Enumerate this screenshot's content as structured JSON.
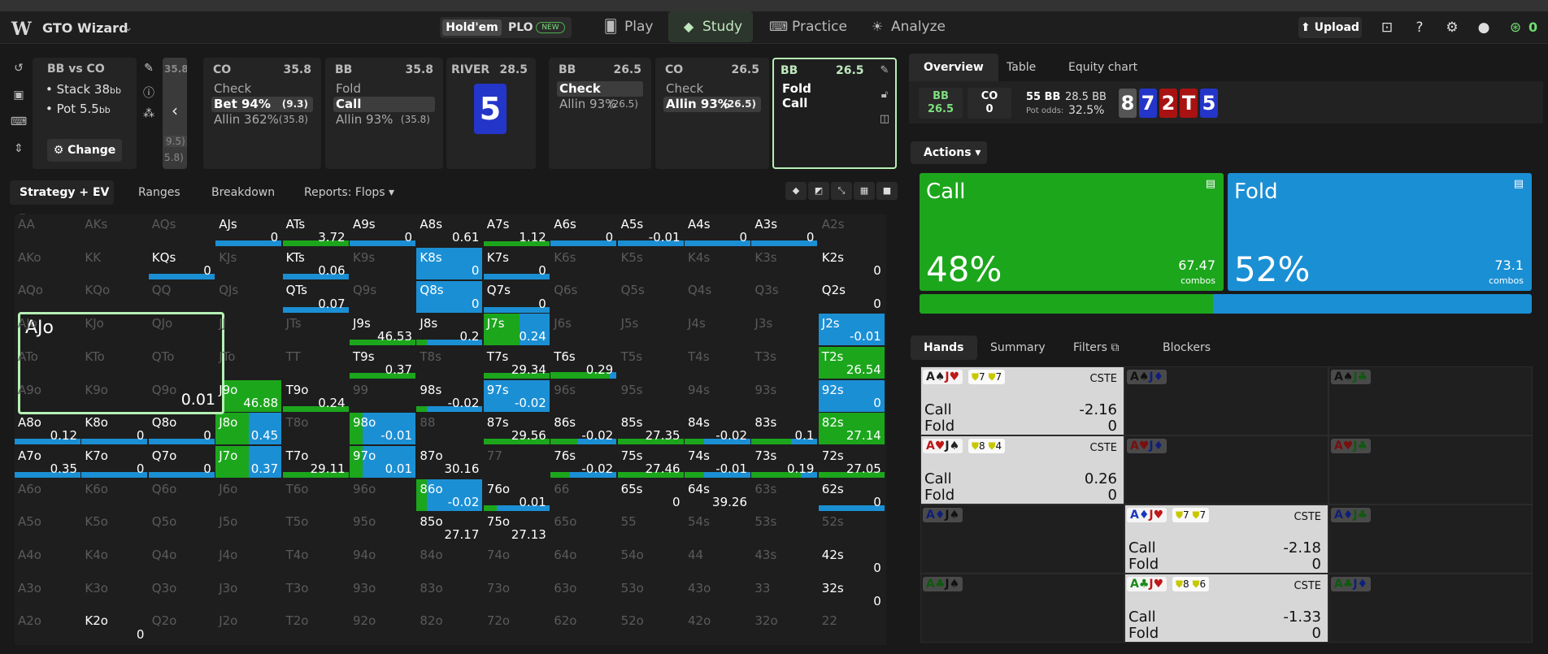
{
  "app": {
    "title": "GTO Wizard",
    "credit": "0"
  },
  "nav": {
    "holdem": "Hold'em",
    "plo": "PLO",
    "new_badge": "NEW",
    "tabs": [
      "Play",
      "Study",
      "Practice",
      "Analyze"
    ],
    "upload": "Upload"
  },
  "spot": {
    "title": "BB vs CO",
    "stack_label": "• Stack 38",
    "stack_unit": "bb",
    "pot_label": "• Pot 5.5",
    "pot_unit": "bb",
    "change": "Change"
  },
  "prev_card": {
    "amount": "35.8",
    "r1": "9.5)",
    "r2": "5.8)"
  },
  "cards": [
    {
      "pos": "CO",
      "amt": "35.8",
      "rows": [
        {
          "label": "Check",
          "sub": "",
          "sel": false
        },
        {
          "label": "Bet 94%",
          "sub": "(9.3)",
          "sel": true
        },
        {
          "label": "Allin 362%",
          "sub": "(35.8)",
          "sel": false
        }
      ]
    },
    {
      "pos": "BB",
      "amt": "35.8",
      "rows": [
        {
          "label": "Fold",
          "sub": "",
          "sel": false
        },
        {
          "label": "Call",
          "sub": "",
          "sel": true
        },
        {
          "label": "Allin 93%",
          "sub": "(35.8)",
          "sel": false
        }
      ]
    },
    {
      "pos": "BB",
      "amt": "26.5",
      "rows": [
        {
          "label": "Check",
          "sub": "",
          "sel": true
        },
        {
          "label": "Allin 93%",
          "sub": "(26.5)",
          "sel": false
        }
      ]
    },
    {
      "pos": "CO",
      "amt": "26.5",
      "rows": [
        {
          "label": "Check",
          "sub": "",
          "sel": false
        },
        {
          "label": "Allin 93%",
          "sub": "(26.5)",
          "sel": true
        }
      ]
    }
  ],
  "river": {
    "label": "RIVER",
    "amt": "28.5",
    "card": "5"
  },
  "current": {
    "pos": "BB",
    "amt": "26.5",
    "a1": "Fold",
    "a2": "Call"
  },
  "subtabs": [
    "Strategy + EV",
    "Ranges",
    "Breakdown",
    "Reports: Flops"
  ],
  "colors": {
    "call": "#1ca61c",
    "fold": "#1b8fd4"
  },
  "grid": {
    "ranks": [
      "A",
      "K",
      "Q",
      "J",
      "T",
      "9",
      "8",
      "7",
      "6",
      "5",
      "4",
      "3",
      "2"
    ],
    "cells": {
      "AJs": {
        "ev": "0",
        "c": 0,
        "f": 100
      },
      "ATs": {
        "ev": "3.72",
        "c": 100,
        "f": 0
      },
      "A9s": {
        "ev": "0",
        "c": 0,
        "f": 100
      },
      "A8s": {
        "ev": "0.61",
        "c": 0,
        "f": 0
      },
      "A7s": {
        "ev": "1.12",
        "c": 100,
        "f": 0,
        "h": 0.15
      },
      "A6s": {
        "ev": "0",
        "c": 0,
        "f": 100
      },
      "A5s": {
        "ev": "-0.01",
        "c": 0,
        "f": 100
      },
      "A4s": {
        "ev": "0",
        "c": 0,
        "f": 100
      },
      "A3s": {
        "ev": "0",
        "c": 0,
        "f": 100
      },
      "KQs": {
        "ev": "0",
        "c": 0,
        "f": 100
      },
      "KTs": {
        "ev": "0.06",
        "c": 0,
        "f": 100
      },
      "K8s": {
        "ev": "0",
        "c": 0,
        "f": 100,
        "h": 1
      },
      "K7s": {
        "ev": "0",
        "c": 0,
        "f": 100
      },
      "K2s": {
        "ev": "0",
        "c": 0,
        "f": 0
      },
      "QTs": {
        "ev": "0.07",
        "c": 0,
        "f": 100
      },
      "Q8s": {
        "ev": "0",
        "c": 0,
        "f": 100,
        "h": 1
      },
      "Q7s": {
        "ev": "0",
        "c": 0,
        "f": 100
      },
      "Q2s": {
        "ev": "0",
        "c": 0,
        "f": 0
      },
      "J9s": {
        "ev": "46.53",
        "c": 100,
        "f": 0
      },
      "J8s": {
        "ev": "0.2",
        "c": 15,
        "f": 85
      },
      "J7s": {
        "ev": "0.24",
        "c": 55,
        "f": 45,
        "h": 1
      },
      "J2s": {
        "ev": "-0.01",
        "c": 0,
        "f": 100,
        "h": 1
      },
      "T9s": {
        "ev": "0.37",
        "c": 100,
        "f": 0
      },
      "T7s": {
        "ev": "29.34",
        "c": 100,
        "f": 0
      },
      "T6s": {
        "ev": "0.29",
        "c": 90,
        "f": 10,
        "h": 0.2
      },
      "T2s": {
        "ev": "26.54",
        "c": 100,
        "f": 0,
        "h": 1
      },
      "J9o": {
        "ev": "46.88",
        "c": 100,
        "f": 0,
        "h": 1
      },
      "T9o": {
        "ev": "0.24",
        "c": 100,
        "f": 0
      },
      "98s": {
        "ev": "-0.02",
        "c": 15,
        "f": 85
      },
      "97s": {
        "ev": "-0.02",
        "c": 0,
        "f": 100,
        "h": 1
      },
      "92s": {
        "ev": "0",
        "c": 0,
        "f": 100,
        "h": 1
      },
      "A8o": {
        "ev": "0.12",
        "c": 0,
        "f": 100
      },
      "K8o": {
        "ev": "0",
        "c": 0,
        "f": 100
      },
      "Q8o": {
        "ev": "0",
        "c": 0,
        "f": 100
      },
      "J8o": {
        "ev": "0.45",
        "c": 50,
        "f": 50,
        "h": 1
      },
      "98o": {
        "ev": "-0.01",
        "c": 20,
        "f": 80,
        "h": 1
      },
      "87s": {
        "ev": "29.56",
        "c": 100,
        "f": 0
      },
      "86s": {
        "ev": "-0.02",
        "c": 40,
        "f": 60
      },
      "85s": {
        "ev": "27.35",
        "c": 100,
        "f": 0
      },
      "84s": {
        "ev": "-0.02",
        "c": 30,
        "f": 70
      },
      "83s": {
        "ev": "0.1",
        "c": 60,
        "f": 40
      },
      "82s": {
        "ev": "27.14",
        "c": 100,
        "f": 0,
        "h": 1
      },
      "A7o": {
        "ev": "0.35",
        "c": 0,
        "f": 100
      },
      "K7o": {
        "ev": "0",
        "c": 0,
        "f": 100
      },
      "Q7o": {
        "ev": "0",
        "c": 0,
        "f": 100
      },
      "J7o": {
        "ev": "0.37",
        "c": 50,
        "f": 50,
        "h": 1
      },
      "T7o": {
        "ev": "29.11",
        "c": 100,
        "f": 0
      },
      "97o": {
        "ev": "0.01",
        "c": 20,
        "f": 80,
        "h": 1
      },
      "87o": {
        "ev": "30.16",
        "c": 0,
        "f": 0
      },
      "76s": {
        "ev": "-0.02",
        "c": 30,
        "f": 70
      },
      "75s": {
        "ev": "27.46",
        "c": 100,
        "f": 0
      },
      "74s": {
        "ev": "-0.01",
        "c": 30,
        "f": 70
      },
      "73s": {
        "ev": "0.19",
        "c": 75,
        "f": 25
      },
      "72s": {
        "ev": "27.05",
        "c": 100,
        "f": 0
      },
      "86o": {
        "ev": "-0.02",
        "c": 15,
        "f": 85,
        "h": 1
      },
      "76o": {
        "ev": "0.01",
        "c": 20,
        "f": 80
      },
      "65s": {
        "ev": "0",
        "c": 0,
        "f": 0
      },
      "64s": {
        "ev": "39.26",
        "c": 0,
        "f": 0
      },
      "62s": {
        "ev": "0",
        "c": 0,
        "f": 100
      },
      "85o": {
        "ev": "27.17",
        "c": 0,
        "f": 0
      },
      "75o": {
        "ev": "27.13",
        "c": 0,
        "f": 0
      },
      "42s": {
        "ev": "0",
        "c": 0,
        "f": 0
      },
      "32s": {
        "ev": "0",
        "c": 0,
        "f": 0
      },
      "K2o": {
        "ev": "0",
        "c": 0,
        "f": 0
      }
    },
    "selected": {
      "hand": "AJo",
      "ev": "0.01"
    }
  },
  "right": {
    "tabs": [
      "Overview",
      "Table",
      "Equity chart"
    ],
    "stats": {
      "bb_label": "BB",
      "bb_val": "26.5",
      "co_label": "CO",
      "co_val": "0",
      "eff": "55 BB",
      "pot": "28.5 BB",
      "odds_label": "Pot odds:",
      "odds": "32.5%"
    },
    "board": [
      {
        "r": "8",
        "c": "#555"
      },
      {
        "r": "7",
        "c": "#2435c9"
      },
      {
        "r": "2",
        "c": "#a81212"
      },
      {
        "r": "T",
        "c": "#a81212"
      },
      {
        "r": "5",
        "c": "#2435c9"
      }
    ],
    "actions_label": "Actions",
    "call": {
      "name": "Call",
      "pct": "48%",
      "combos": "67.47",
      "combos_label": "combos",
      "freq": 48
    },
    "fold": {
      "name": "Fold",
      "pct": "52%",
      "combos": "73.1",
      "combos_label": "combos",
      "freq": 52
    },
    "hand_tabs": [
      "Hands",
      "Summary",
      "Filters",
      "Blockers"
    ],
    "hands": [
      {
        "combo": [
          [
            "A",
            "s"
          ],
          [
            "J",
            "h"
          ]
        ],
        "active": true,
        "blk": [
          [
            "7",
            "7"
          ]
        ],
        "cste": "CSTE",
        "call": "-2.16",
        "fold": "0"
      },
      {
        "combo": [
          [
            "A",
            "s"
          ],
          [
            "J",
            "d"
          ]
        ],
        "active": false
      },
      {
        "combo": [
          [
            "A",
            "s"
          ],
          [
            "J",
            "c"
          ]
        ],
        "active": false
      },
      {
        "combo": [
          [
            "A",
            "h"
          ],
          [
            "J",
            "s"
          ]
        ],
        "active": true,
        "blk": [
          [
            "8",
            "4"
          ]
        ],
        "cste": "CSTE",
        "call": "0.26",
        "fold": "0"
      },
      {
        "combo": [
          [
            "A",
            "h"
          ],
          [
            "J",
            "d"
          ]
        ],
        "active": false
      },
      {
        "combo": [
          [
            "A",
            "h"
          ],
          [
            "J",
            "c"
          ]
        ],
        "active": false
      },
      {
        "combo": [
          [
            "A",
            "d"
          ],
          [
            "J",
            "s"
          ]
        ],
        "active": false
      },
      {
        "combo": [
          [
            "A",
            "d"
          ],
          [
            "J",
            "h"
          ]
        ],
        "active": true,
        "blk": [
          [
            "7",
            "7"
          ]
        ],
        "cste": "CSTE",
        "call": "-2.18",
        "fold": "0"
      },
      {
        "combo": [
          [
            "A",
            "d"
          ],
          [
            "J",
            "c"
          ]
        ],
        "active": false
      },
      {
        "combo": [
          [
            "A",
            "c"
          ],
          [
            "J",
            "s"
          ]
        ],
        "active": false
      },
      {
        "combo": [
          [
            "A",
            "c"
          ],
          [
            "J",
            "h"
          ]
        ],
        "active": true,
        "blk": [
          [
            "8",
            "6"
          ]
        ],
        "cste": "CSTE",
        "call": "-1.33",
        "fold": "0"
      },
      {
        "combo": [
          [
            "A",
            "c"
          ],
          [
            "J",
            "d"
          ]
        ],
        "active": false
      }
    ],
    "row_labels": {
      "call": "Call",
      "fold": "Fold"
    }
  }
}
